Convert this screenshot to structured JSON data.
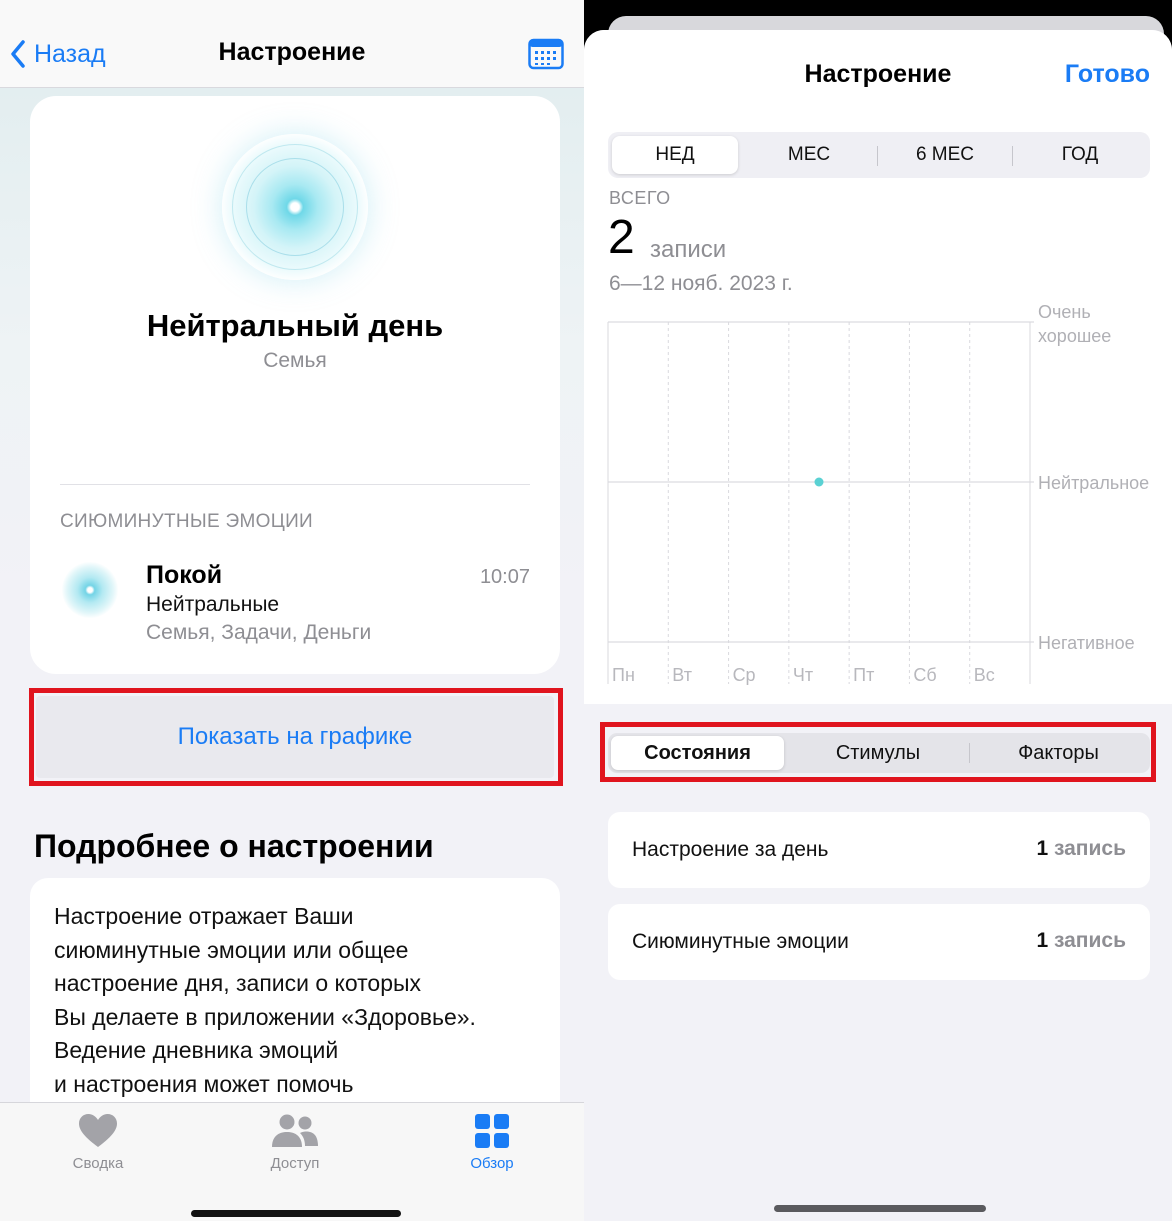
{
  "left": {
    "nav": {
      "back_label": "Назад",
      "title": "Настроение"
    },
    "card": {
      "title": "Нейтральный день",
      "subtitle": "Семья",
      "section_caption": "СИЮМИНУТНЫЕ ЭМОЦИИ",
      "entry": {
        "name": "Покой",
        "time": "10:07",
        "mood": "Нейтральные",
        "tags": "Семья, Задачи, Деньги"
      }
    },
    "show_on_chart_label": "Показать на графике",
    "about": {
      "title": "Подробнее о настроении",
      "lines": [
        "Настроение отражает Ваши",
        "сиюминутные эмоции или общее",
        "настроение дня, записи о которых",
        "Вы делаете в приложении «Здоровье».",
        "Ведение дневника эмоций",
        "и настроения может помочь"
      ]
    },
    "tabbar": {
      "tabs": [
        {
          "label": "Сводка",
          "icon": "heart-icon",
          "active": false
        },
        {
          "label": "Доступ",
          "icon": "people-icon",
          "active": false
        },
        {
          "label": "Обзор",
          "icon": "grid-icon",
          "active": true
        }
      ]
    }
  },
  "right": {
    "title": "Настроение",
    "done_label": "Готово",
    "range_options": [
      "НЕД",
      "МЕС",
      "6 МЕС",
      "ГОД"
    ],
    "range_selected": "НЕД",
    "total_caption": "ВСЕГО",
    "total_count": "2",
    "total_unit": "записи",
    "date_range": "6—12 нояб. 2023 г.",
    "state_options": [
      "Состояния",
      "Стимулы",
      "Факторы"
    ],
    "state_selected": "Состояния",
    "stats": [
      {
        "label": "Настроение за день",
        "count": "1",
        "unit": "запись"
      },
      {
        "label": "Сиюминутные эмоции",
        "count": "1",
        "unit": "запись"
      }
    ]
  },
  "chart_data": {
    "type": "scatter",
    "categories": [
      "Пн",
      "Вт",
      "Ср",
      "Чт",
      "Пт",
      "Сб",
      "Вс"
    ],
    "y_levels": [
      {
        "lines": [
          "Очень",
          "хорошее"
        ],
        "value": 1
      },
      {
        "lines": [
          "Нейтральное"
        ],
        "value": 0
      },
      {
        "lines": [
          "Негативное"
        ],
        "value": -1
      }
    ],
    "ylim": [
      -1,
      1
    ],
    "points": [
      {
        "x": "Чт",
        "y": 0
      }
    ],
    "point_color": "#5ad1d3",
    "grid": true
  },
  "colors": {
    "accent": "#1a7cf5",
    "highlight_frame": "#e0141e"
  }
}
